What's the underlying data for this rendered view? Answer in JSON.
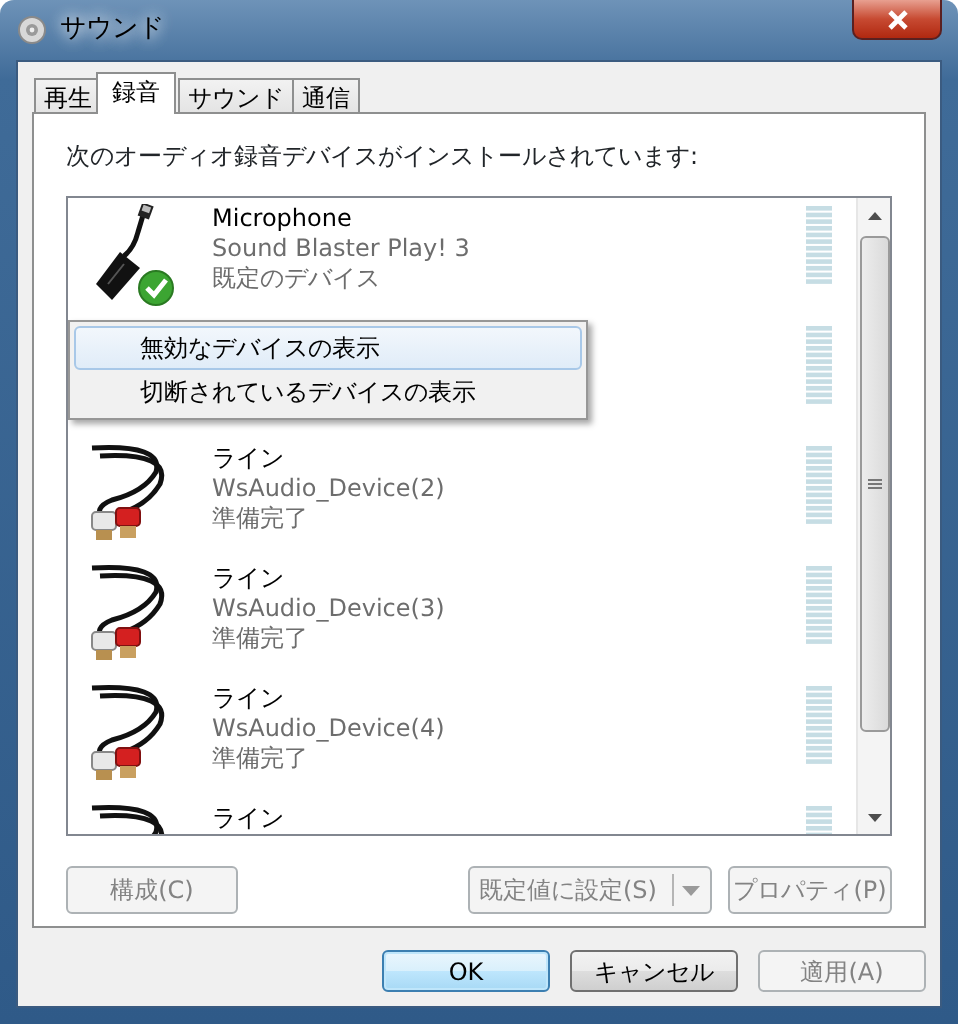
{
  "window": {
    "title": "サウンド"
  },
  "tabs": [
    {
      "label": "再生",
      "selected": false
    },
    {
      "label": "録音",
      "selected": true
    },
    {
      "label": "サウンド",
      "selected": false
    },
    {
      "label": "通信",
      "selected": false
    }
  ],
  "heading": "次のオーディオ録音デバイスがインストールされています:",
  "devices": [
    {
      "kind": "usb",
      "name": "Microphone",
      "description": "Sound Blaster Play! 3",
      "status": "既定のデバイス",
      "default": true
    },
    {
      "kind": "covered",
      "default": false
    },
    {
      "kind": "cable",
      "name": "ライン",
      "description": "WsAudio_Device(2)",
      "status": "準備完了",
      "default": false
    },
    {
      "kind": "cable",
      "name": "ライン",
      "description": "WsAudio_Device(3)",
      "status": "準備完了",
      "default": false
    },
    {
      "kind": "cable",
      "name": "ライン",
      "description": "WsAudio_Device(4)",
      "status": "準備完了",
      "default": false
    },
    {
      "kind": "cable",
      "name": "ライン",
      "default": false
    }
  ],
  "context_menu": [
    {
      "label": "無効なデバイスの表示",
      "selected": true
    },
    {
      "label": "切断されているデバイスの表示",
      "selected": false
    }
  ],
  "panel_buttons": [
    {
      "label": "構成(C)",
      "disabled": true,
      "kind": "plain"
    },
    {
      "label": "既定値に設定(S)",
      "disabled": true,
      "kind": "split"
    },
    {
      "label": "プロパティ(P)",
      "disabled": true,
      "kind": "plain"
    }
  ],
  "dialog_buttons": [
    {
      "label": "OK",
      "disabled": false,
      "default": true
    },
    {
      "label": "キャンセル",
      "disabled": false,
      "default": false
    },
    {
      "label": "適用(A)",
      "disabled": true,
      "default": false
    }
  ]
}
